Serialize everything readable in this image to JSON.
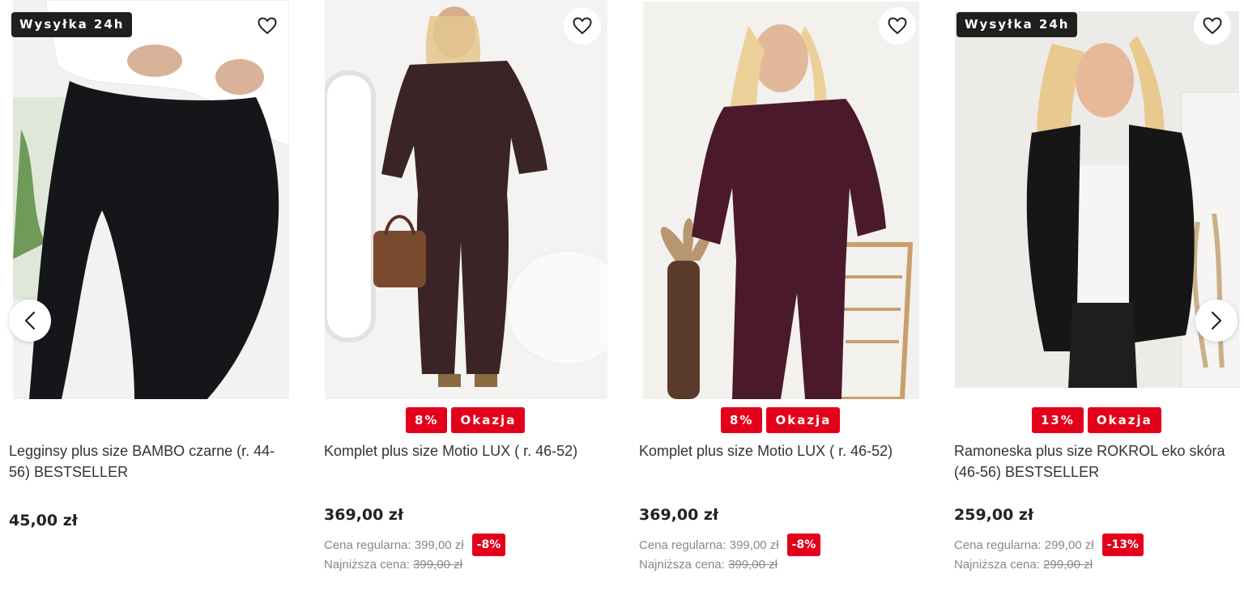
{
  "carousel": {
    "prev_icon": "chevron-left-icon",
    "next_icon": "chevron-right-icon"
  },
  "products": [
    {
      "ship_badge": "Wysyłka 24h",
      "title": "Legginsy plus size BAMBO czarne (r. 44-56) BESTSELLER",
      "price": "45,00 zł",
      "photo": {
        "bg": "#f2f2f0",
        "garment": "#16161a",
        "accent": "#ffffff"
      }
    },
    {
      "promo_percent": "8%",
      "promo_label": "Okazja",
      "title": "Komplet plus size Motio LUX ( r. 46-52)",
      "price": "369,00 zł",
      "regular_label": "Cena regularna:",
      "regular_price": "399,00 zł",
      "regular_discount": "-8%",
      "lowest_label": "Najniższa cena:",
      "lowest_price": "399,00 zł",
      "photo": {
        "bg": "#f4f3f1",
        "garment": "#3a2426",
        "accent": "#7a4a2e"
      }
    },
    {
      "promo_percent": "8%",
      "promo_label": "Okazja",
      "title": "Komplet plus size Motio LUX ( r. 46-52)",
      "price": "369,00 zł",
      "regular_label": "Cena regularna:",
      "regular_price": "399,00 zł",
      "regular_discount": "-8%",
      "lowest_label": "Najniższa cena:",
      "lowest_price": "399,00 zł",
      "photo": {
        "bg": "#f3f1ee",
        "garment": "#4a1a2c",
        "accent": "#c9a06a"
      }
    },
    {
      "ship_badge": "Wysyłka 24h",
      "promo_percent": "13%",
      "promo_label": "Okazja",
      "title": "Ramoneska plus size ROKROL eko skóra (46-56) BESTSELLER",
      "price": "259,00 zł",
      "regular_label": "Cena regularna:",
      "regular_price": "299,00 zł",
      "regular_discount": "-13%",
      "lowest_label": "Najniższa cena:",
      "lowest_price": "299,00 zł",
      "photo": {
        "bg": "#ecebe8",
        "garment": "#161616",
        "accent": "#f5f5f5"
      }
    }
  ],
  "colors": {
    "promo_red": "#e3001b",
    "badge_dark": "#1f1f1f"
  }
}
